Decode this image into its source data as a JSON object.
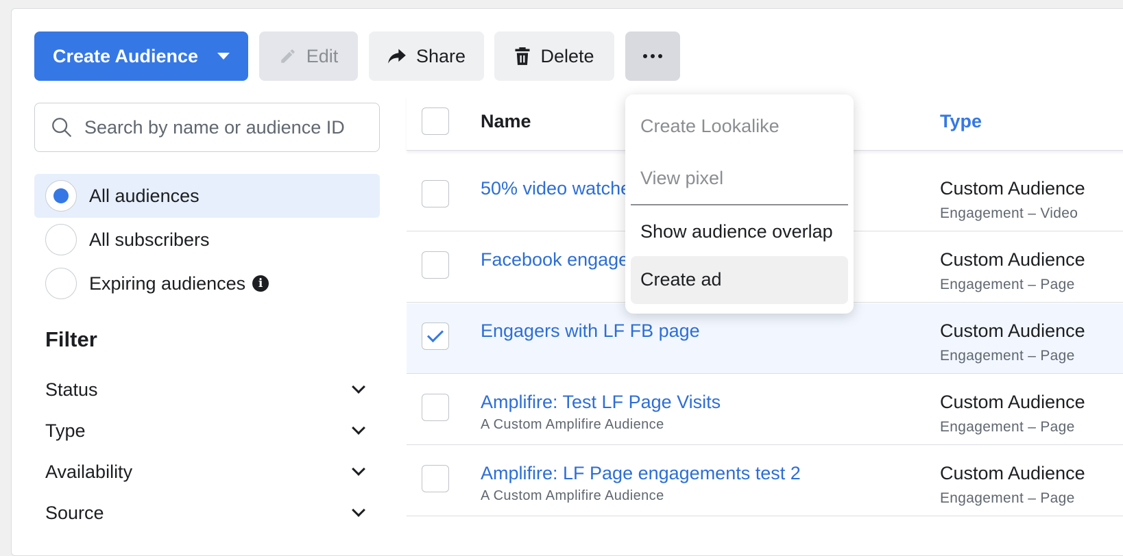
{
  "toolbar": {
    "create_label": "Create Audience",
    "edit_label": "Edit",
    "share_label": "Share",
    "delete_label": "Delete"
  },
  "search": {
    "placeholder": "Search by name or audience ID"
  },
  "audience_filters": [
    {
      "label": "All audiences",
      "selected": true
    },
    {
      "label": "All subscribers",
      "selected": false
    },
    {
      "label": "Expiring audiences",
      "selected": false
    }
  ],
  "filter": {
    "title": "Filter",
    "items": [
      "Status",
      "Type",
      "Availability",
      "Source"
    ]
  },
  "table": {
    "headers": {
      "name": "Name",
      "type": "Type"
    },
    "rows": [
      {
        "name": "50% video watche",
        "desc": "",
        "type": "Custom Audience",
        "subtype": "Engagement – Video",
        "checked": false
      },
      {
        "name": "Facebook engage",
        "desc": "",
        "type": "Custom Audience",
        "subtype": "Engagement – Page",
        "checked": false
      },
      {
        "name": "Engagers with LF FB page",
        "desc": "",
        "type": "Custom Audience",
        "subtype": "Engagement – Page",
        "checked": true
      },
      {
        "name": "Amplifire: Test LF Page Visits",
        "desc": "A Custom Amplifire Audience",
        "type": "Custom Audience",
        "subtype": "Engagement – Page",
        "checked": false
      },
      {
        "name": "Amplifire: LF Page engagements test 2",
        "desc": "A Custom Amplifire Audience",
        "type": "Custom Audience",
        "subtype": "Engagement – Page",
        "checked": false
      }
    ]
  },
  "more_menu": {
    "items": [
      {
        "label": "Create Lookalike",
        "disabled": true
      },
      {
        "label": "View pixel",
        "disabled": true
      },
      {
        "label": "Show audience overlap",
        "disabled": false
      },
      {
        "label": "Create ad",
        "disabled": false
      }
    ]
  },
  "colors": {
    "accent": "#3578e5",
    "link": "#2d6ed6",
    "selected_row": "#f2f7ff"
  }
}
